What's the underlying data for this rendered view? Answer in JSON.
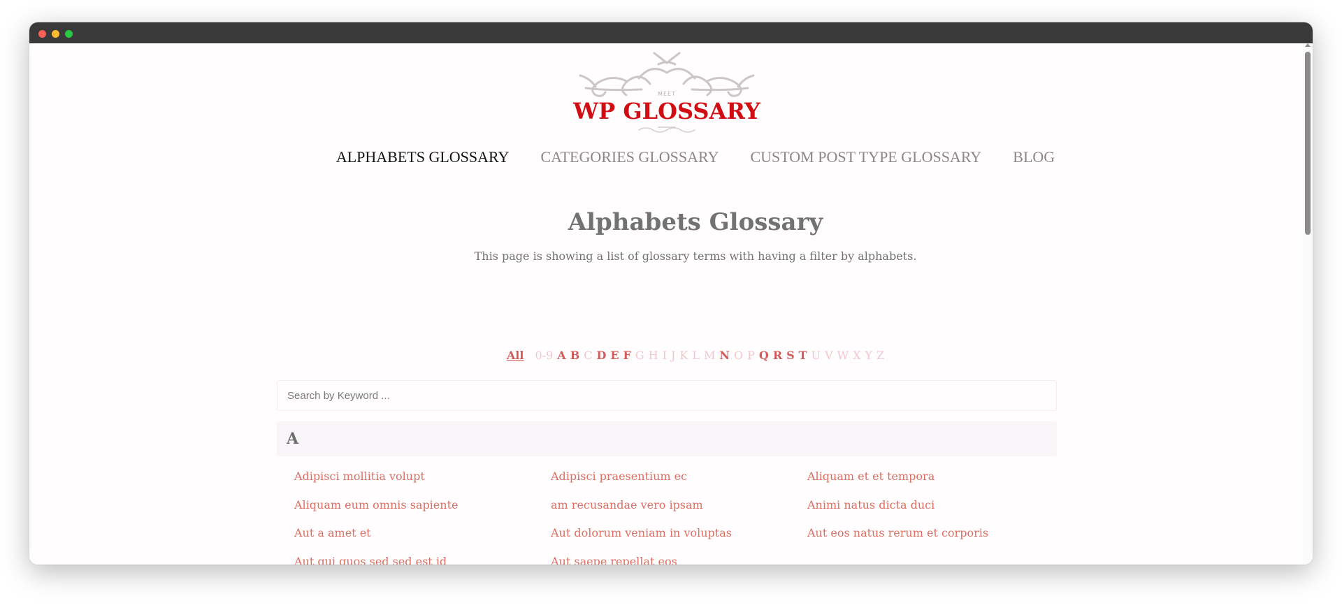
{
  "window": {
    "controls": [
      "close",
      "minimize",
      "maximize"
    ]
  },
  "logo": {
    "meet": "MEET",
    "title": "WP GLOSSARY"
  },
  "nav": {
    "items": [
      {
        "label": "ALPHABETS GLOSSARY",
        "active": true
      },
      {
        "label": "CATEGORIES GLOSSARY",
        "active": false
      },
      {
        "label": "CUSTOM POST TYPE GLOSSARY",
        "active": false
      },
      {
        "label": "BLOG",
        "active": false
      }
    ]
  },
  "page": {
    "title": "Alphabets Glossary",
    "description": "This page is showing a list of glossary terms with having a filter by alphabets."
  },
  "alphabet_filter": {
    "all_label": "All",
    "letters": [
      {
        "label": "0-9",
        "enabled": false
      },
      {
        "label": "A",
        "enabled": true
      },
      {
        "label": "B",
        "enabled": true
      },
      {
        "label": "C",
        "enabled": false
      },
      {
        "label": "D",
        "enabled": true
      },
      {
        "label": "E",
        "enabled": true
      },
      {
        "label": "F",
        "enabled": true
      },
      {
        "label": "G",
        "enabled": false
      },
      {
        "label": "H",
        "enabled": false
      },
      {
        "label": "I",
        "enabled": false
      },
      {
        "label": "J",
        "enabled": false
      },
      {
        "label": "K",
        "enabled": false
      },
      {
        "label": "L",
        "enabled": false
      },
      {
        "label": "M",
        "enabled": false
      },
      {
        "label": "N",
        "enabled": true
      },
      {
        "label": "O",
        "enabled": false
      },
      {
        "label": "P",
        "enabled": false
      },
      {
        "label": "Q",
        "enabled": true
      },
      {
        "label": "R",
        "enabled": true
      },
      {
        "label": "S",
        "enabled": true
      },
      {
        "label": "T",
        "enabled": true
      },
      {
        "label": "U",
        "enabled": false
      },
      {
        "label": "V",
        "enabled": false
      },
      {
        "label": "W",
        "enabled": false
      },
      {
        "label": "X",
        "enabled": false
      },
      {
        "label": "Y",
        "enabled": false
      },
      {
        "label": "Z",
        "enabled": false
      }
    ]
  },
  "search": {
    "placeholder": "Search by Keyword ...",
    "value": ""
  },
  "sections": [
    {
      "letter": "A",
      "terms": [
        "Adipisci mollitia volupt",
        "Adipisci praesentium ec",
        "Aliquam et et tempora",
        "Aliquam eum omnis sapiente",
        "am recusandae vero ipsam",
        "Animi natus dicta duci",
        "Aut a amet et",
        "Aut dolorum veniam in voluptas",
        "Aut eos natus rerum et corporis",
        "Aut qui quos sed sed est id",
        "Aut saepe repellat eos"
      ]
    }
  ],
  "colors": {
    "brand_red": "#d10c12",
    "link": "#dc6e62",
    "active_letter": "#d35b5b",
    "disabled_letter": "#f1c8c9"
  }
}
